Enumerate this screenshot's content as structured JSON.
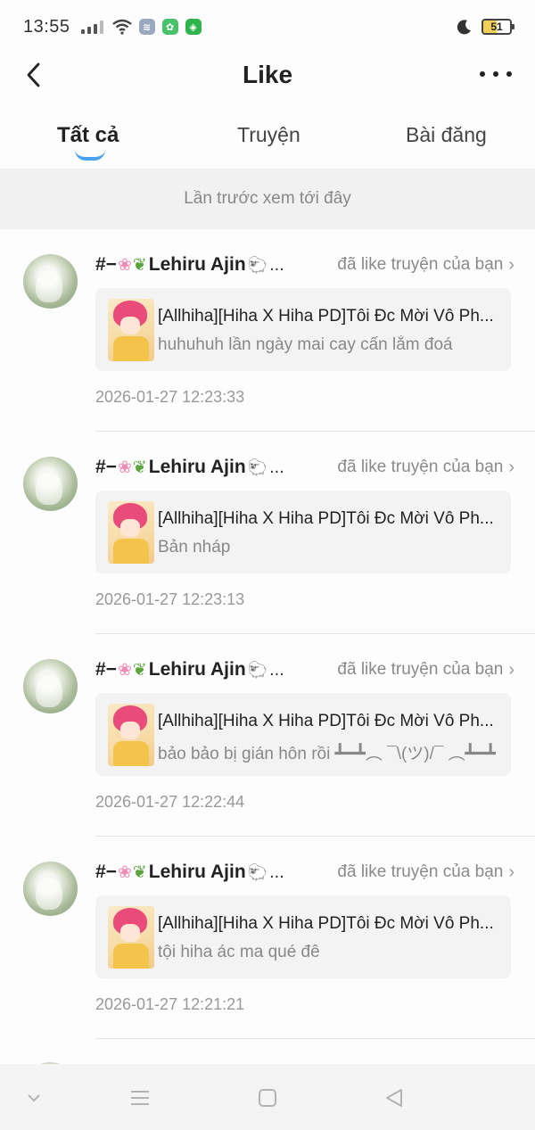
{
  "status_bar": {
    "time": "13:55",
    "battery": "51",
    "colors": {
      "badge_1": "#9aa9bf",
      "badge_2": "#48c26a",
      "badge_3": "#2fb34b"
    }
  },
  "header": {
    "title": "Like",
    "back_icon": "chevron-left-icon",
    "more_icon": "more-dots-icon"
  },
  "tabs": [
    {
      "label": "Tất cả",
      "active": true
    },
    {
      "label": "Truyện",
      "active": false
    },
    {
      "label": "Bài đăng",
      "active": false
    }
  ],
  "banner": {
    "text": "Lần trước xem tới đây"
  },
  "items": [
    {
      "user": "#−",
      "user_name": "Lehiru Ajin",
      "ellipsis": "...",
      "action": "đã like truyện của bạn",
      "story_title": "[Allhiha][Hiha X Hiha PD]Tôi Đc Mời Vô Ph...",
      "comment": "huhuhuh lần ngày mai cay cấn lắm đoá",
      "timestamp": "2026-01-27 12:23:33"
    },
    {
      "user": "#−",
      "user_name": "Lehiru Ajin",
      "ellipsis": "...",
      "action": "đã like truyện của bạn",
      "story_title": "[Allhiha][Hiha X Hiha PD]Tôi Đc Mời Vô Ph...",
      "comment": "Bản nháp",
      "timestamp": "2026-01-27 12:23:13"
    },
    {
      "user": "#−",
      "user_name": "Lehiru Ajin",
      "ellipsis": "...",
      "action": "đã like truyện của bạn",
      "story_title": "[Allhiha][Hiha X Hiha PD]Tôi Đc Mời Vô Ph...",
      "comment": "bảo bảo bị gián hôn rồi ┻━┻︵ ¯\\(ツ)/¯ ︵┻━┻",
      "timestamp": "2026-01-27 12:22:44"
    },
    {
      "user": "#−",
      "user_name": "Lehiru Ajin",
      "ellipsis": "...",
      "action": "đã like truyện của bạn",
      "story_title": "[Allhiha][Hiha X Hiha PD]Tôi Đc Mời Vô Ph...",
      "comment": "tội hiha ác ma qué đê",
      "timestamp": "2026-01-27 12:21:21"
    }
  ],
  "bottom_nav": {
    "icons": [
      "nav-hide-icon",
      "nav-menu-icon",
      "nav-home-icon",
      "nav-back-icon"
    ]
  },
  "accent_color": "#4aa3f0"
}
